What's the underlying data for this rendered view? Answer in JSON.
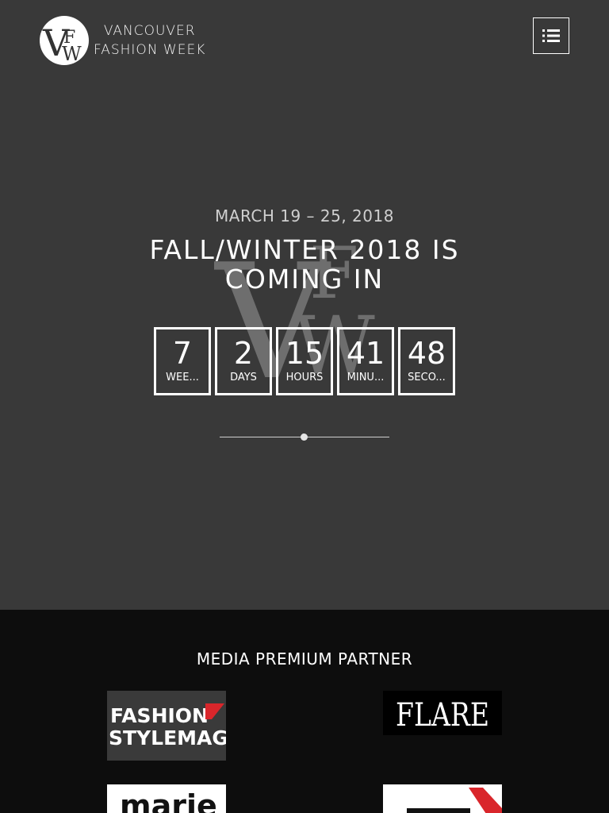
{
  "header": {
    "logo_line1": "VANCOUVER",
    "logo_line2": "FASHION WEEK",
    "menu_icon": "list-icon"
  },
  "hero": {
    "date": "MARCH 19 – 25, 2018",
    "headline_line1": "FALL/WINTER 2018 IS",
    "headline_line2": "COMING IN",
    "countdown": [
      {
        "value": "7",
        "label": "WEE..."
      },
      {
        "value": "2",
        "label": "DAYS"
      },
      {
        "value": "15",
        "label": "HOURS"
      },
      {
        "value": "41",
        "label": "MINU..."
      },
      {
        "value": "48",
        "label": "SECO..."
      }
    ]
  },
  "partners": {
    "title": "MEDIA PREMIUM PARTNER",
    "logos": [
      {
        "line1": "FASHION",
        "line2": "STYLEMAG"
      },
      {
        "line1": "FLARE"
      },
      {
        "line1": "marie"
      },
      {
        "line1": ""
      }
    ]
  },
  "colors": {
    "hero_bg": "#393939",
    "partners_bg": "#0d0d0d",
    "accent_red": "#d9262b"
  }
}
